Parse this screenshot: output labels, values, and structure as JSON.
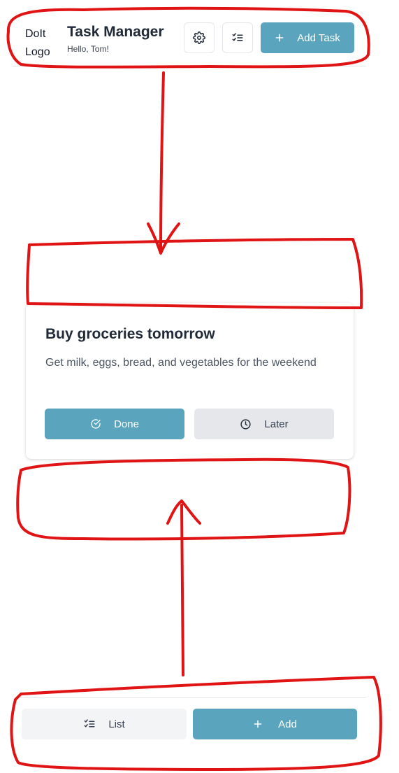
{
  "header": {
    "logo_text": "DoIt Logo",
    "title": "Task Manager",
    "greeting": "Hello, Tom!",
    "settings_icon": "gear-icon",
    "list_icon": "checklist-icon",
    "add_task_label": "Add Task",
    "add_task_icon": "plus-icon"
  },
  "task": {
    "title": "Buy groceries tomorrow",
    "description": "Get milk, eggs, bread, and vegetables for the weekend",
    "done_label": "Done",
    "done_icon": "check-circle-icon",
    "later_label": "Later",
    "later_icon": "clock-icon"
  },
  "footer": {
    "list_label": "List",
    "list_icon": "checklist-icon",
    "add_label": "Add",
    "add_icon": "plus-icon"
  },
  "colors": {
    "primary": "#5aa5bd",
    "secondary_button": "#e5e7eb",
    "annotation": "#e01414"
  }
}
